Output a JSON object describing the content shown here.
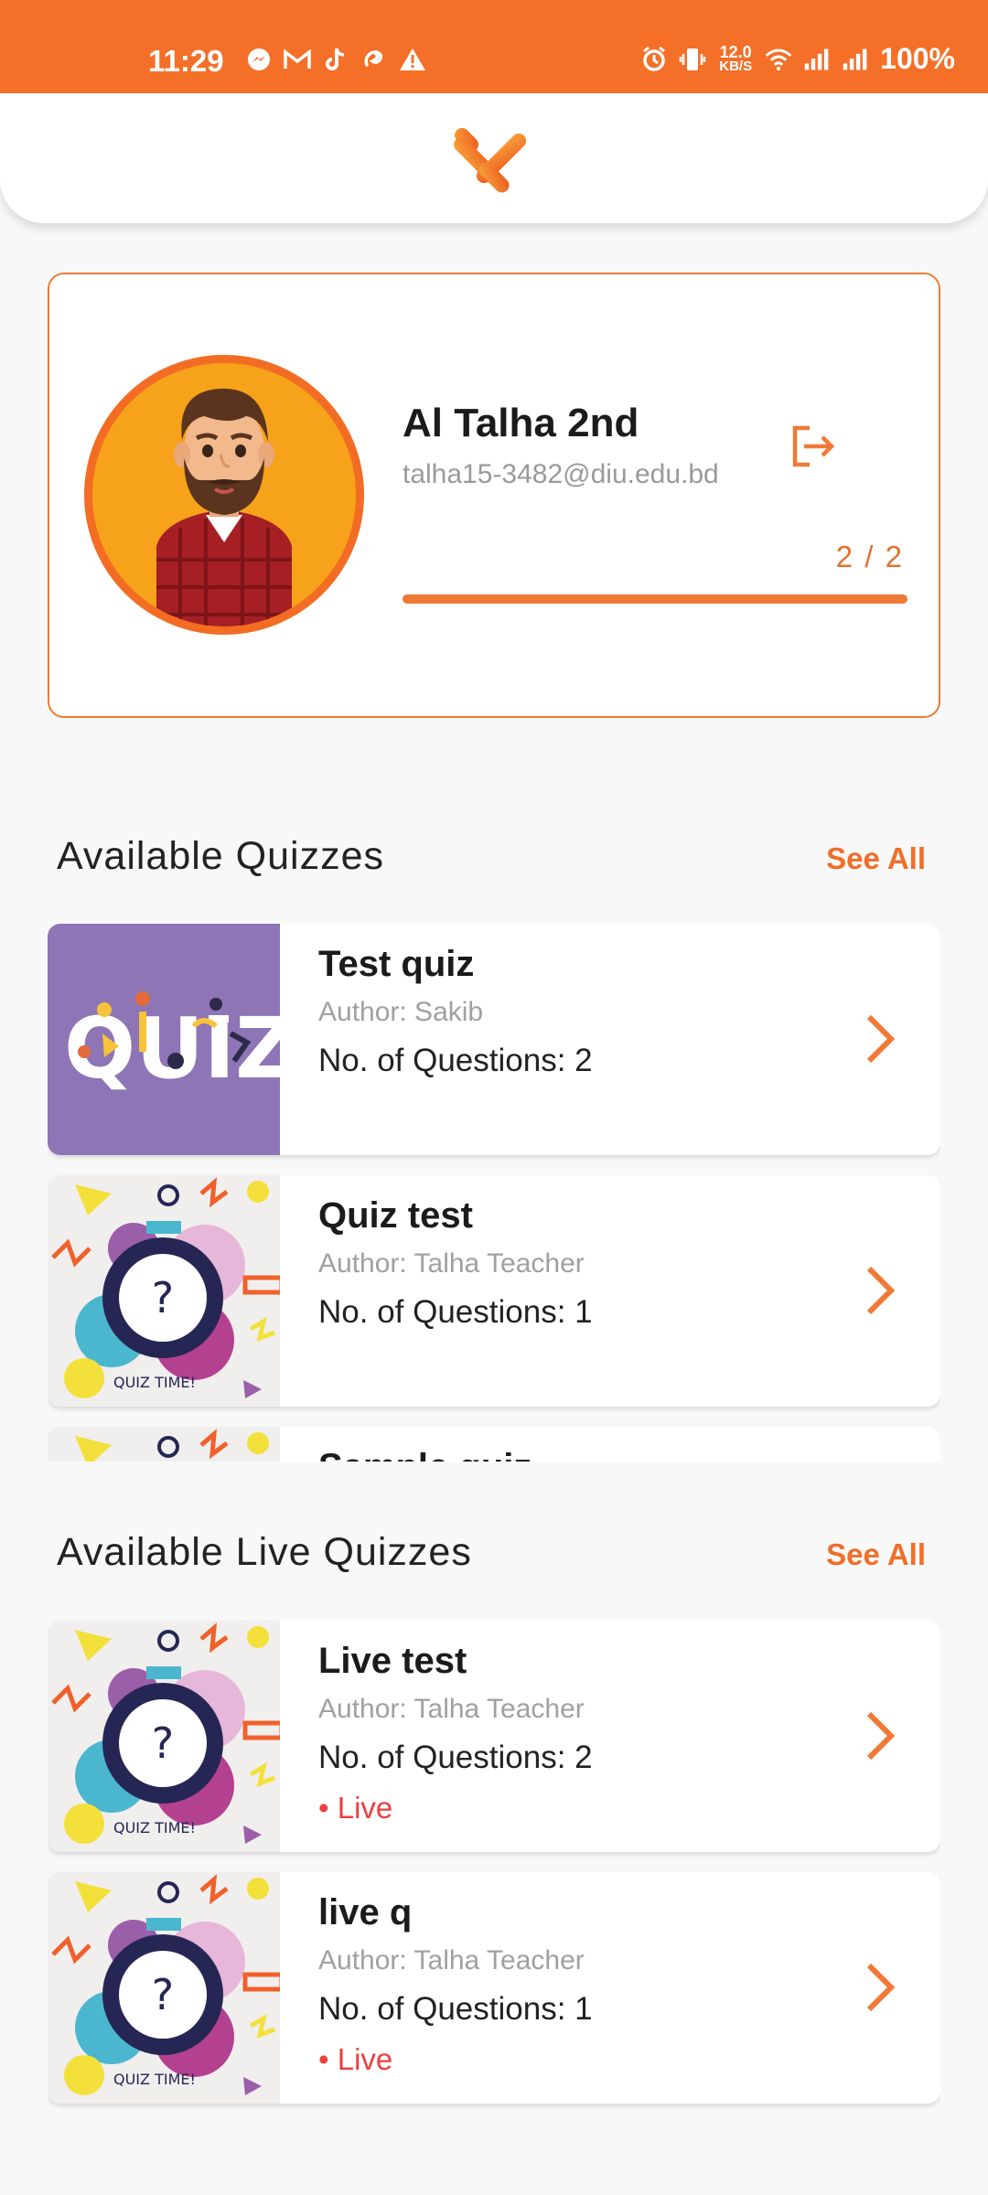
{
  "status_bar": {
    "time": "11:29",
    "speed_top": "12.0",
    "speed_bottom": "KB/S",
    "battery": "100%"
  },
  "profile": {
    "name": "Al Talha 2nd",
    "email": "talha15-3482@diu.edu.bd",
    "progress_text": "2 / 2",
    "progress_fraction": 1.0
  },
  "available_quizzes": {
    "title": "Available Quizzes",
    "see_all": "See All",
    "items": [
      {
        "title": "Test quiz",
        "author": "Author: Sakib",
        "questions": "No. of Questions: 2",
        "thumb": "quiz-banner"
      },
      {
        "title": "Quiz test",
        "author": "Author: Talha Teacher",
        "questions": "No. of Questions: 1",
        "thumb": "quiz-time"
      },
      {
        "title": "Sample quiz",
        "author": "",
        "questions": "",
        "thumb": "quiz-time"
      }
    ]
  },
  "live_quizzes": {
    "title": "Available Live Quizzes",
    "see_all": "See All",
    "items": [
      {
        "title": "Live test",
        "author": "Author: Talha Teacher",
        "questions": "No. of Questions: 2",
        "live": "• Live",
        "thumb": "quiz-time"
      },
      {
        "title": "live q",
        "author": "Author: Talha Teacher",
        "questions": "No. of Questions: 1",
        "live": "• Live",
        "thumb": "quiz-time"
      }
    ]
  },
  "thumb_text": {
    "quiz_banner": "QUIZ",
    "quiz_time": "QUIZ TIME!",
    "question_mark": "?"
  },
  "colors": {
    "accent": "#f47028",
    "live": "#ee3f3f",
    "background": "#f8f8f8"
  }
}
